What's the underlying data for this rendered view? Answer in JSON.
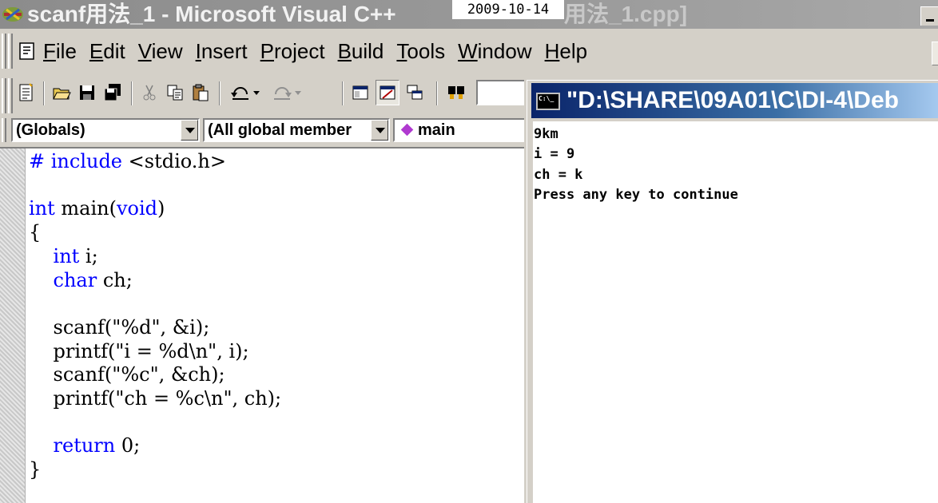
{
  "window": {
    "title": "scanf用法_1 - Microsoft Visual C++",
    "title_tail": "用法_1.cpp]",
    "date_overlay": "2009-10-14"
  },
  "menu": {
    "items": [
      {
        "key": "F",
        "rest": "ile"
      },
      {
        "key": "E",
        "rest": "dit"
      },
      {
        "key": "V",
        "rest": "iew"
      },
      {
        "key": "I",
        "rest": "nsert"
      },
      {
        "key": "P",
        "rest": "roject"
      },
      {
        "key": "B",
        "rest": "uild"
      },
      {
        "key": "T",
        "rest": "ools"
      },
      {
        "key": "W",
        "rest": "indow"
      },
      {
        "key": "H",
        "rest": "elp"
      }
    ]
  },
  "toolbar": {
    "buttons": [
      "new-text-file-icon",
      "open-folder-icon",
      "save-icon",
      "save-all-icon",
      "cut-icon",
      "copy-icon",
      "paste-icon",
      "undo-icon",
      "redo-icon",
      "workspace-icon",
      "output-icon",
      "window-list-icon",
      "find-in-files-icon"
    ]
  },
  "wizard": {
    "scope": "(Globals)",
    "filter": "(All global member",
    "function": "main"
  },
  "editor": {
    "lines": [
      [
        {
          "t": "# include",
          "k": true
        },
        {
          "t": " <stdio.h>"
        }
      ],
      [
        {
          "t": ""
        }
      ],
      [
        {
          "t": "int",
          "k": true
        },
        {
          "t": " main("
        },
        {
          "t": "void",
          "k": true
        },
        {
          "t": ")"
        }
      ],
      [
        {
          "t": "{"
        }
      ],
      [
        {
          "t": "    "
        },
        {
          "t": "int",
          "k": true
        },
        {
          "t": " i;"
        }
      ],
      [
        {
          "t": "    "
        },
        {
          "t": "char",
          "k": true
        },
        {
          "t": " ch;"
        }
      ],
      [
        {
          "t": ""
        }
      ],
      [
        {
          "t": "    scanf(\"%d\", &i);"
        }
      ],
      [
        {
          "t": "    printf(\"i = %d\\n\", i);"
        }
      ],
      [
        {
          "t": "    scanf(\"%c\", &ch);"
        }
      ],
      [
        {
          "t": "    printf(\"ch = %c\\n\", ch);"
        }
      ],
      [
        {
          "t": ""
        }
      ],
      [
        {
          "t": "    "
        },
        {
          "t": "return",
          "k": true
        },
        {
          "t": " 0;"
        }
      ],
      [
        {
          "t": "}"
        }
      ]
    ]
  },
  "console": {
    "title": "\"D:\\SHARE\\09A01\\C\\DI-4\\Deb",
    "output": [
      "9km",
      "i = 9",
      "ch = k",
      "Press any key to continue"
    ]
  },
  "colors": {
    "keyword": "#0000ff",
    "console_title_start": "#0a246a",
    "console_title_end": "#a6caf0",
    "inactive_title": "#9a9a9a"
  }
}
